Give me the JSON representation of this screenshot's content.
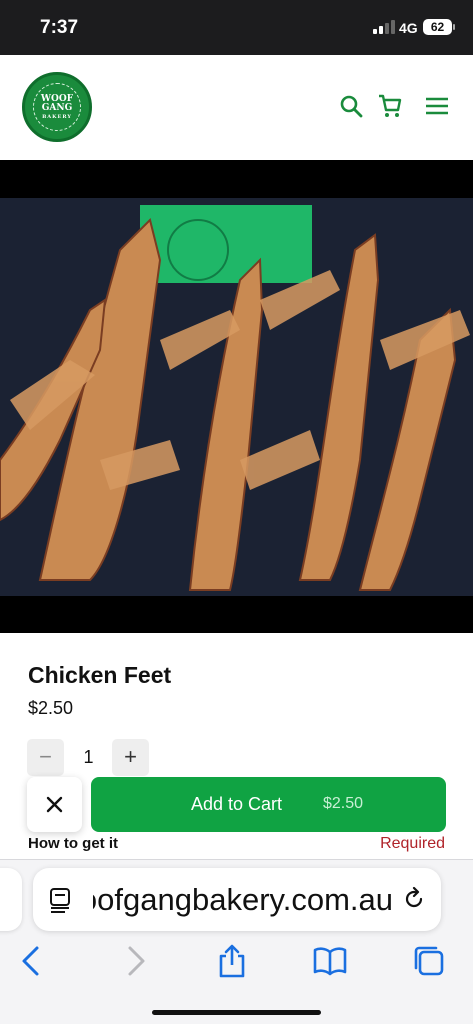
{
  "status_bar": {
    "time": "7:37",
    "network": "4G",
    "battery": "62"
  },
  "header": {
    "logo": {
      "title_line1": "WOOF",
      "title_line2": "GANG",
      "subtitle": "BAKERY"
    },
    "icons": [
      "search-icon",
      "cart-icon",
      "menu-icon"
    ],
    "accent_color": "#1a8b3c"
  },
  "product": {
    "title": "Chicken Feet",
    "price": "$2.50",
    "quantity": "1",
    "qty_minus": "−",
    "qty_plus": "+"
  },
  "add_to_cart": {
    "label": "Add to Cart",
    "price": "$2.50",
    "color": "#10a343"
  },
  "fulfillment": {
    "label": "How to get it",
    "required": "Required"
  },
  "browser": {
    "url": "woofgangbakery.com.au",
    "toolbar": [
      "back-icon",
      "forward-icon",
      "share-icon",
      "bookmarks-icon",
      "tabs-icon"
    ]
  }
}
